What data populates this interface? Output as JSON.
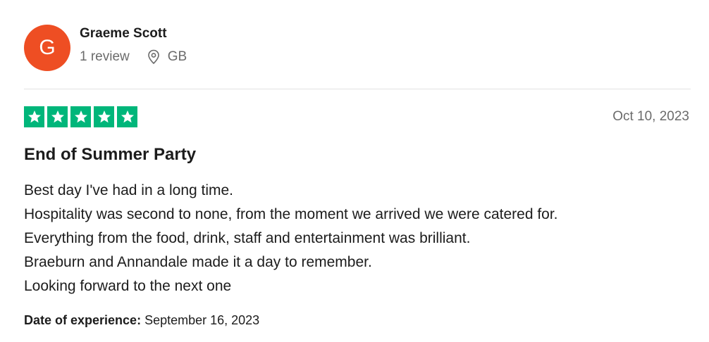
{
  "reviewer": {
    "initial": "G",
    "avatar_color": "#ee4e23",
    "name": "Graeme Scott",
    "review_count": "1 review",
    "country": "GB",
    "location_icon": "location-pin-icon"
  },
  "review": {
    "rating": 5,
    "max_rating": 5,
    "star_color": "#00b67a",
    "date": "Oct 10, 2023",
    "title": "End of Summer Party",
    "lines": [
      "Best day I've had in a long time.",
      "Hospitality was second to none, from the moment we arrived we were catered for.",
      "Everything from the food, drink, staff and entertainment was brilliant.",
      "Braeburn and Annandale made it a day to remember.",
      "Looking forward to the next one"
    ],
    "experience_label": "Date of experience:",
    "experience_date": "September 16, 2023"
  }
}
